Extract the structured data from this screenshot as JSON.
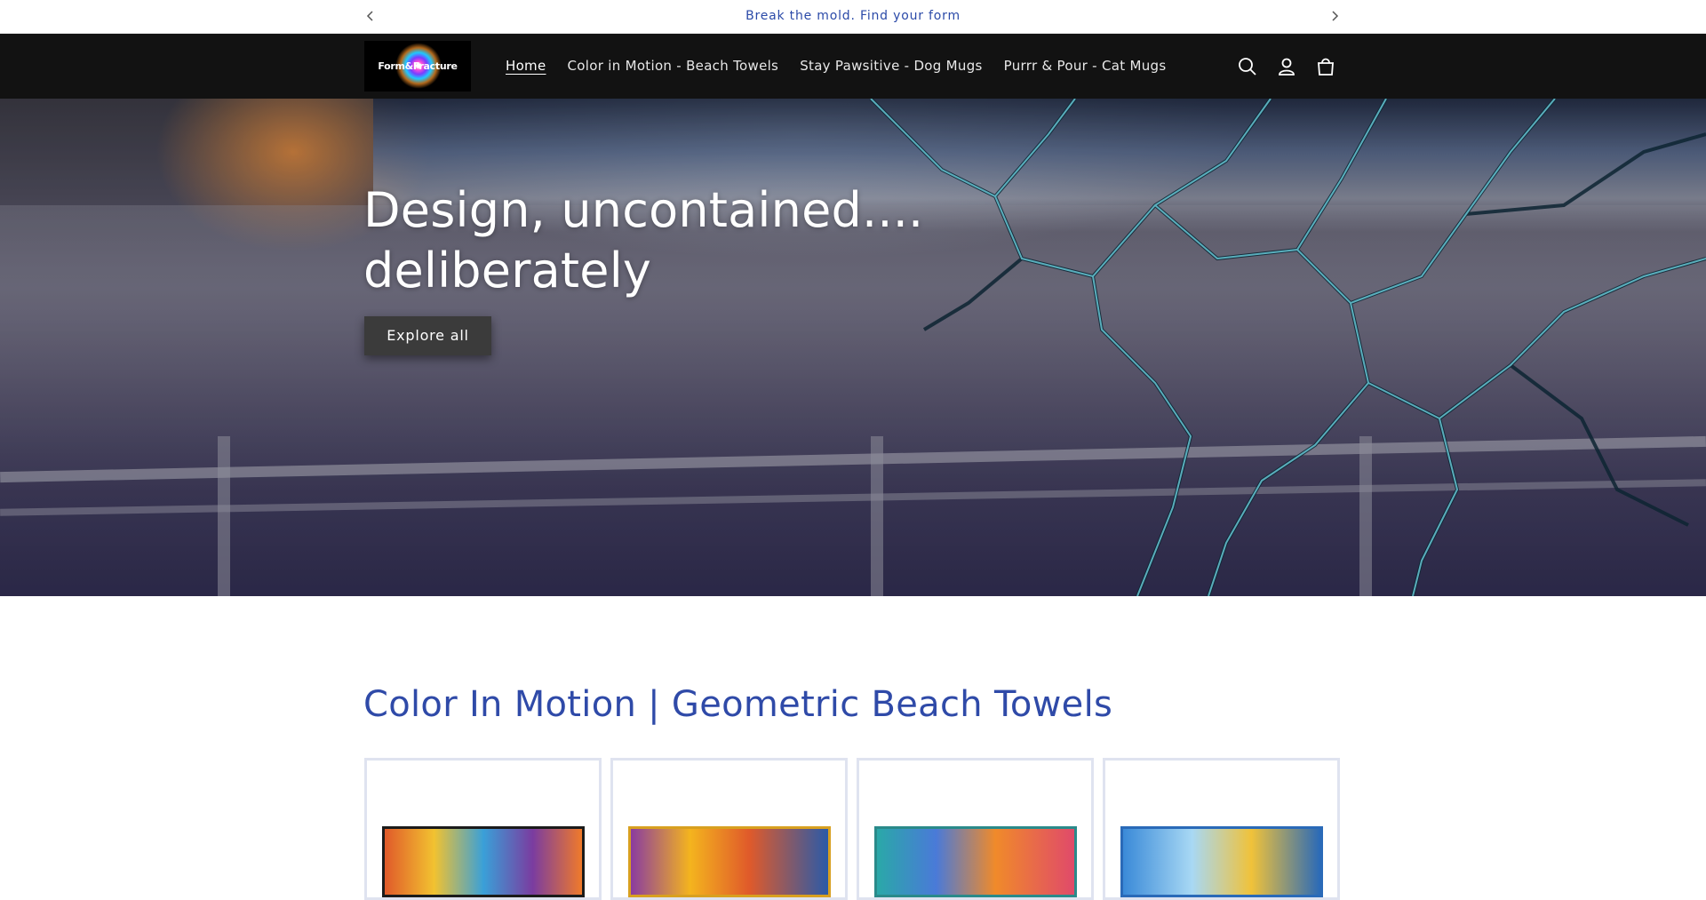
{
  "announcement": {
    "message": "Break the mold. Find your form"
  },
  "header": {
    "logo_text": "Form&Fracture",
    "nav": [
      {
        "label": "Home",
        "active": true
      },
      {
        "label": "Color in Motion - Beach Towels",
        "active": false
      },
      {
        "label": "Stay Pawsitive - Dog Mugs",
        "active": false
      },
      {
        "label": "Purrr & Pour - Cat Mugs",
        "active": false
      }
    ],
    "icons": [
      "search-icon",
      "account-icon",
      "cart-icon"
    ]
  },
  "hero": {
    "heading": "Design, uncontained.... deliberately",
    "button_label": "Explore all"
  },
  "collection": {
    "title": "Color In Motion | Geometric Beach Towels",
    "products": [
      {
        "name": "towel-1",
        "palette": [
          "#f07a2a",
          "#3aa0d8",
          "#7a3ca0",
          "#f2c230"
        ]
      },
      {
        "name": "towel-2",
        "palette": [
          "#f4b41e",
          "#e05a2a",
          "#2a5aa8",
          "#8a3ca0"
        ]
      },
      {
        "name": "towel-3",
        "palette": [
          "#2aa8a8",
          "#f08a2a",
          "#4a7ad8",
          "#e04a6a"
        ]
      },
      {
        "name": "towel-4",
        "palette": [
          "#3a8ad8",
          "#a8d8f4",
          "#f0c23a",
          "#2a6ab8"
        ]
      }
    ]
  },
  "colors": {
    "accent": "#2f4aa8",
    "header_bg": "#121212"
  }
}
